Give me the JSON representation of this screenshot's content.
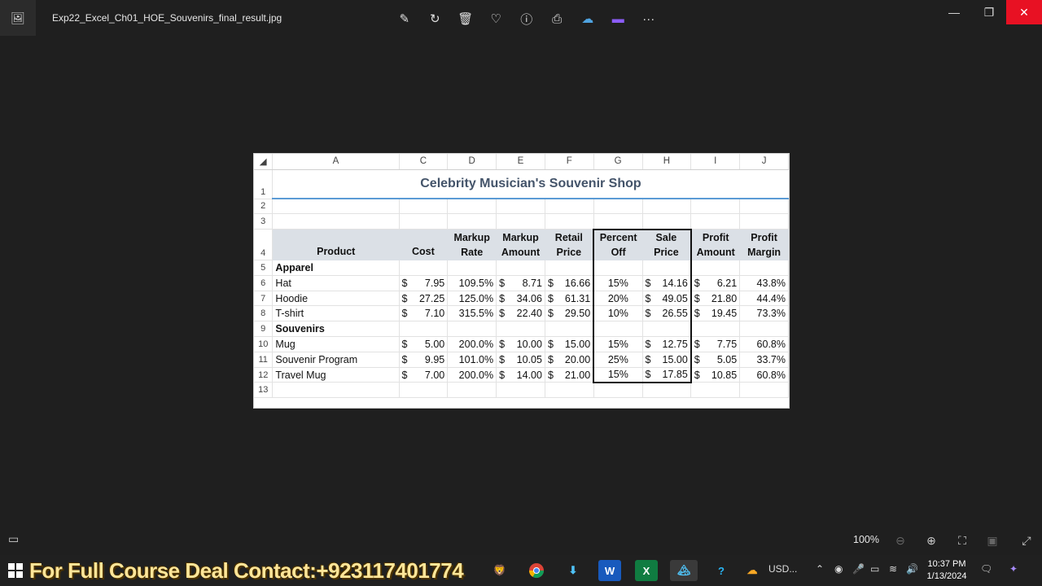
{
  "window": {
    "file_title": "Exp22_Excel_Ch01_HOE_Souvenirs_final_result.jpg",
    "toolbar_icons": [
      "edit-icon",
      "rotate-icon",
      "delete-icon",
      "favorite-icon",
      "info-icon",
      "print-icon",
      "onedrive-icon",
      "clipchamp-icon",
      "more-icon"
    ],
    "toolbar_glyphs": [
      "✎",
      "↻",
      "🗑",
      "♡",
      "ⓘ",
      "⎙",
      "☁",
      "▬",
      "···"
    ],
    "controls": {
      "minimize": "—",
      "restore": "❐",
      "close": "✕"
    }
  },
  "sheet": {
    "column_headers": [
      "A",
      "C",
      "D",
      "E",
      "F",
      "G",
      "H",
      "I",
      "J"
    ],
    "title": "Celebrity Musician's Souvenir Shop",
    "headers": {
      "product": "Product",
      "cost": "Cost",
      "markup_rate": "Markup Rate",
      "markup_amount": "Markup Amount",
      "retail_price": "Retail Price",
      "percent_off": "Percent Off",
      "sale_price": "Sale Price",
      "profit_amount": "Profit Amount",
      "profit_margin": "Profit Margin"
    },
    "row_numbers": [
      "1",
      "2",
      "3",
      "4",
      "5",
      "6",
      "7",
      "8",
      "9",
      "10",
      "11",
      "12",
      "13"
    ],
    "groups": [
      {
        "name": "Apparel",
        "items": [
          {
            "product": "Hat",
            "cost": "7.95",
            "markup_rate": "109.5%",
            "markup_amount": "8.71",
            "retail_price": "16.66",
            "percent_off": "15%",
            "sale_price": "14.16",
            "profit_amount": "6.21",
            "profit_margin": "43.8%"
          },
          {
            "product": "Hoodie",
            "cost": "27.25",
            "markup_rate": "125.0%",
            "markup_amount": "34.06",
            "retail_price": "61.31",
            "percent_off": "20%",
            "sale_price": "49.05",
            "profit_amount": "21.80",
            "profit_margin": "44.4%"
          },
          {
            "product": "T-shirt",
            "cost": "7.10",
            "markup_rate": "315.5%",
            "markup_amount": "22.40",
            "retail_price": "29.50",
            "percent_off": "10%",
            "sale_price": "26.55",
            "profit_amount": "19.45",
            "profit_margin": "73.3%"
          }
        ]
      },
      {
        "name": "Souvenirs",
        "items": [
          {
            "product": "Mug",
            "cost": "5.00",
            "markup_rate": "200.0%",
            "markup_amount": "10.00",
            "retail_price": "15.00",
            "percent_off": "15%",
            "sale_price": "12.75",
            "profit_amount": "7.75",
            "profit_margin": "60.8%"
          },
          {
            "product": "Souvenir Program",
            "cost": "9.95",
            "markup_rate": "101.0%",
            "markup_amount": "10.05",
            "retail_price": "20.00",
            "percent_off": "25%",
            "sale_price": "15.00",
            "profit_amount": "5.05",
            "profit_margin": "33.7%"
          },
          {
            "product": "Travel Mug",
            "cost": "7.00",
            "markup_rate": "200.0%",
            "markup_amount": "14.00",
            "retail_price": "21.00",
            "percent_off": "15%",
            "sale_price": "17.85",
            "profit_amount": "10.85",
            "profit_margin": "60.8%"
          }
        ]
      }
    ],
    "currency_symbol": "$"
  },
  "statusbar": {
    "zoom": "100%"
  },
  "taskbar": {
    "promo_text": "For Full Course Deal Contact:+923117401774",
    "weather": "USD...",
    "time": "10:37 PM",
    "date": "1/13/2024"
  }
}
